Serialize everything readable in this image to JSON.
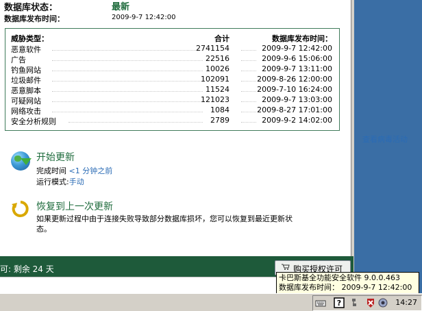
{
  "status": {
    "db_status_label": "数据库状态：",
    "db_status_value": "最新",
    "db_release_label": "数据库发布时间：",
    "db_release_value": "2009-9-7 12:42:00"
  },
  "threats": {
    "headers": {
      "type": "威胁类型：",
      "total": "合计",
      "release": "数据库发布时间："
    },
    "rows": [
      {
        "name": "恶意软件",
        "total": "2741154",
        "date": "2009-9-7 12:42:00"
      },
      {
        "name": "广告",
        "total": "22516",
        "date": "2009-9-6 15:06:00"
      },
      {
        "name": "钓鱼网站",
        "total": "10026",
        "date": "2009-9-7 13:11:00"
      },
      {
        "name": "垃圾邮件",
        "total": "102091",
        "date": "2009-8-26 12:00:00"
      },
      {
        "name": "恶意脚本",
        "total": "11524",
        "date": "2009-7-10 16:24:00"
      },
      {
        "name": "可疑网站",
        "total": "121023",
        "date": "2009-9-7 13:03:00"
      },
      {
        "name": "网络攻击",
        "total": "1084",
        "date": "2009-8-27 17:01:00"
      },
      {
        "name": "安全分析规则",
        "total": "2789",
        "date": "2009-9-2 14:02:00"
      }
    ],
    "view_link": "查看病毒活动"
  },
  "update": {
    "title": "开始更新",
    "completed_label": "完成时间",
    "completed_value": "<1 分钟之前",
    "mode_label": "运行模式:",
    "mode_value": "手动"
  },
  "rollback": {
    "title": "恢复到上一次更新",
    "desc_line1": "如果更新过程中由于连接失败导致部分数据库损坏，您可以恢复到最近更新状",
    "desc_line2": "态。"
  },
  "license": {
    "text": "可: 剩余 24 天",
    "buy_label": "购买授权许可"
  },
  "tooltip": {
    "line1": "卡巴斯基全功能安全软件 9.0.0.463",
    "line2": "数据库发布时间： 2009-9-7 12:42:00"
  },
  "taskbar": {
    "clock": "14:27",
    "icons": [
      "keyboard-icon",
      "help-icon",
      "network-icon",
      "kaspersky-icon",
      "speaker-icon"
    ]
  },
  "colors": {
    "accent_green": "#1e6b3c",
    "link_blue": "#2a6bb5",
    "desktop_blue": "#3a6ea5",
    "bar_green": "#1e5a3a"
  }
}
